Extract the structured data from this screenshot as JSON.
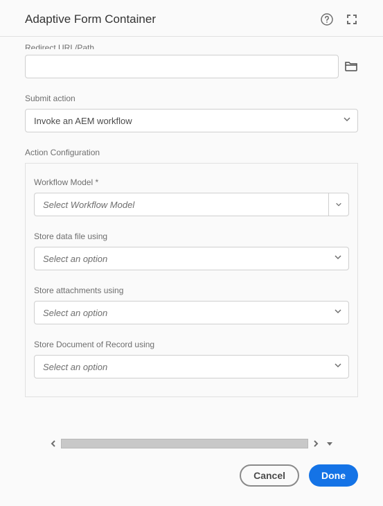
{
  "header": {
    "title": "Adaptive Form Container",
    "help_icon": "help-circle-icon",
    "fullscreen_icon": "fullscreen-icon"
  },
  "form": {
    "redirect_label": "Redirect URL/Path",
    "redirect_value": "",
    "submit_action_label": "Submit action",
    "submit_action_value": "Invoke an AEM workflow",
    "action_config_label": "Action Configuration",
    "workflow_model_label": "Workflow Model *",
    "workflow_model_placeholder": "Select Workflow Model",
    "store_data_label": "Store data file using",
    "store_data_placeholder": "Select an option",
    "store_attach_label": "Store attachments using",
    "store_attach_placeholder": "Select an option",
    "store_dor_label": "Store Document of Record using",
    "store_dor_placeholder": "Select an option"
  },
  "footer": {
    "cancel_label": "Cancel",
    "done_label": "Done"
  }
}
